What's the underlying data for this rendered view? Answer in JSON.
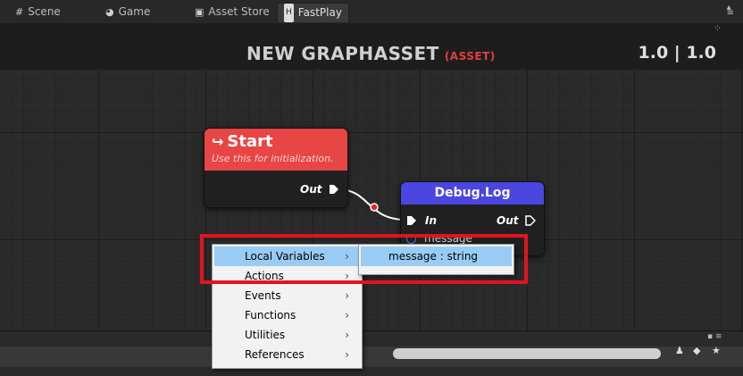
{
  "tabs": [
    {
      "label": "Scene",
      "icon": "grid-icon"
    },
    {
      "label": "Game",
      "icon": "pacman-icon"
    },
    {
      "label": "Asset Store",
      "icon": "bag-icon"
    },
    {
      "label": "FastPlay",
      "icon": "h-icon"
    }
  ],
  "graph": {
    "title": "NEW GRAPHASSET",
    "title_tag": "(ASSET)",
    "version": "1.0 | 1.0"
  },
  "nodes": {
    "start": {
      "title": "Start",
      "subtitle": "Use this for initialization.",
      "out_label": "Out"
    },
    "debug": {
      "title": "Debug.Log",
      "in_label": "In",
      "out_label": "Out",
      "param_label": "message"
    }
  },
  "context_menu": {
    "items": [
      {
        "label": "Local Variables",
        "highlighted": true
      },
      {
        "label": "Actions"
      },
      {
        "label": "Events"
      },
      {
        "label": "Functions"
      },
      {
        "label": "Utilities"
      },
      {
        "label": "References"
      }
    ],
    "submenu_item": "message : string"
  },
  "colors": {
    "start_node": "#e84545",
    "debug_node": "#4b46e0",
    "highlight": "#99ccf4",
    "annotation": "#e0141f"
  }
}
